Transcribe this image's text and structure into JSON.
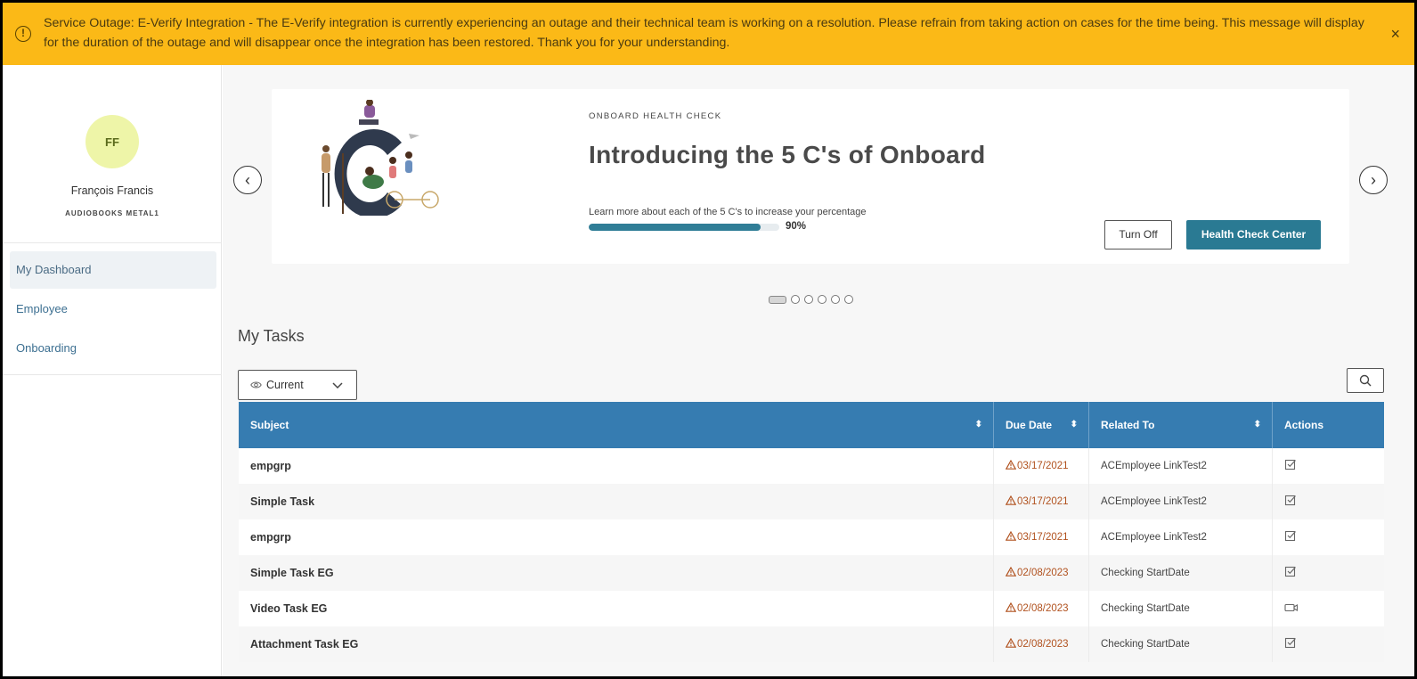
{
  "banner": {
    "message": "Service Outage: E-Verify Integration - The E-Verify integration is currently experiencing an outage and their technical team is working on a resolution. Please refrain from taking action on cases for the time being. This message will display for the duration of the outage and will disappear once the integration has been restored. Thank you for your understanding.",
    "warning_icon": "!",
    "close_icon": "×",
    "color": "#fbb917"
  },
  "sidebar": {
    "avatar_initials": "FF",
    "user_name": "François Francis",
    "company": "AUDIOBOOKS METAL1",
    "items": [
      {
        "label": "My Dashboard",
        "active": true
      },
      {
        "label": "Employee",
        "active": false
      },
      {
        "label": "Onboarding",
        "active": false
      }
    ]
  },
  "carousel": {
    "label": "ONBOARD HEALTH CHECK",
    "title": "Introducing the 5 C's of Onboard",
    "description": "Learn more about each of the 5 C's to increase your percentage",
    "progress_percent": 90,
    "progress_text": "90%",
    "turn_off_label": "Turn Off",
    "health_check_label": "Health Check Center",
    "prev_icon": "‹",
    "next_icon": "›",
    "slides_total": 6,
    "active_slide": 0,
    "accent_color": "#2a7a93"
  },
  "tasks": {
    "title": "My Tasks",
    "filter_value": "Current",
    "columns": [
      "Subject",
      "Due Date",
      "Related To",
      "Actions"
    ],
    "header_color": "#367cb1",
    "rows": [
      {
        "subject": "empgrp",
        "due": "03/17/2021",
        "related": "ACEmployee LinkTest2",
        "action_icon": "checkbox-edit-icon"
      },
      {
        "subject": "Simple Task",
        "due": "03/17/2021",
        "related": "ACEmployee LinkTest2",
        "action_icon": "checkbox-edit-icon"
      },
      {
        "subject": "empgrp",
        "due": "03/17/2021",
        "related": "ACEmployee LinkTest2",
        "action_icon": "checkbox-edit-icon"
      },
      {
        "subject": "Simple Task EG",
        "due": "02/08/2023",
        "related": "Checking StartDate",
        "action_icon": "checkbox-edit-icon"
      },
      {
        "subject": "Video Task EG",
        "due": "02/08/2023",
        "related": "Checking StartDate",
        "action_icon": "video-icon"
      },
      {
        "subject": "Attachment Task EG",
        "due": "02/08/2023",
        "related": "Checking StartDate",
        "action_icon": "checkbox-edit-icon"
      }
    ]
  }
}
